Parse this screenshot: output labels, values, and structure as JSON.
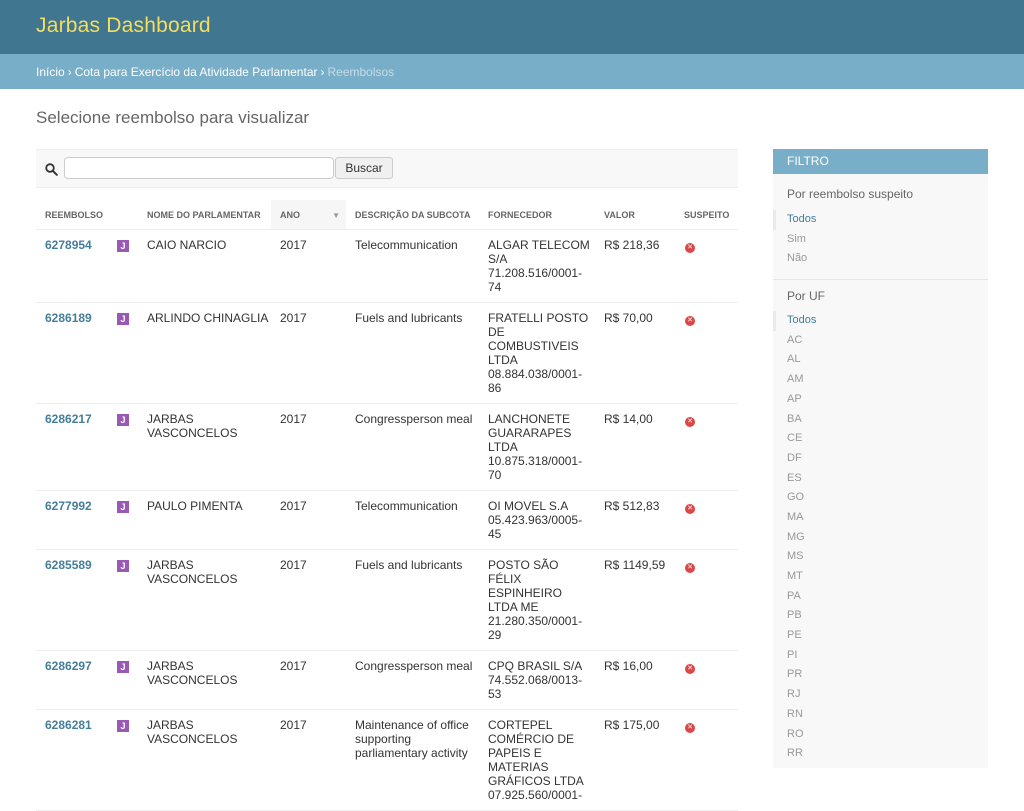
{
  "header": {
    "brand": "Jarbas Dashboard"
  },
  "breadcrumbs": {
    "home": "Início",
    "section": "Cota para Exercício da Atividade Parlamentar",
    "current": "Reembolsos",
    "separator": "›"
  },
  "page_title": "Selecione reembolso para visualizar",
  "search": {
    "placeholder": "",
    "value": "",
    "button": "Buscar",
    "icon": "search-icon"
  },
  "table": {
    "columns": {
      "reembolso": "REEMBOLSO",
      "parlamentar": "NOME DO PARLAMENTAR",
      "ano": "ANO",
      "subcota": "DESCRIÇÃO DA SUBCOTA",
      "fornecedor": "FORNECEDOR",
      "valor": "VALOR",
      "suspeito": "SUSPEITO"
    },
    "sorted_column": "ano",
    "jarbas_icon_letter": "J",
    "suspeito_icon_glyph": "✕",
    "rows": [
      {
        "id": "6278954",
        "name": "CAIO NARCIO",
        "year": "2017",
        "subquota": "Telecommunication",
        "supplier": "ALGAR TELECOM S/A 71.208.516/0001-74",
        "value": "R$ 218,36",
        "suspicious": false
      },
      {
        "id": "6286189",
        "name": "ARLINDO CHINAGLIA",
        "year": "2017",
        "subquota": "Fuels and lubricants",
        "supplier": "FRATELLI POSTO DE COMBUSTIVEIS LTDA 08.884.038/0001-86",
        "value": "R$ 70,00",
        "suspicious": false
      },
      {
        "id": "6286217",
        "name": "JARBAS VASCONCELOS",
        "year": "2017",
        "subquota": "Congressperson meal",
        "supplier": "LANCHONETE GUARARAPES LTDA 10.875.318/0001-70",
        "value": "R$ 14,00",
        "suspicious": false
      },
      {
        "id": "6277992",
        "name": "PAULO PIMENTA",
        "year": "2017",
        "subquota": "Telecommunication",
        "supplier": "OI MOVEL S.A 05.423.963/0005-45",
        "value": "R$ 512,83",
        "suspicious": false
      },
      {
        "id": "6285589",
        "name": "JARBAS VASCONCELOS",
        "year": "2017",
        "subquota": "Fuels and lubricants",
        "supplier": "POSTO SÃO FÉLIX ESPINHEIRO LTDA ME 21.280.350/0001-29",
        "value": "R$ 1149,59",
        "suspicious": false
      },
      {
        "id": "6286297",
        "name": "JARBAS VASCONCELOS",
        "year": "2017",
        "subquota": "Congressperson meal",
        "supplier": "CPQ BRASIL S/A 74.552.068/0013-53",
        "value": "R$ 16,00",
        "suspicious": false
      },
      {
        "id": "6286281",
        "name": "JARBAS VASCONCELOS",
        "year": "2017",
        "subquota": "Maintenance of office supporting parliamentary activity",
        "supplier": "CORTEPEL COMÉRCIO DE PAPEIS E MATERIAS GRÁFICOS LTDA 07.925.560/0001-",
        "value": "R$ 175,00",
        "suspicious": false
      }
    ]
  },
  "filter": {
    "title": "FILTRO",
    "suspicious": {
      "title": "Por reembolso suspeito",
      "selected": "Todos",
      "options": [
        "Todos",
        "Sim",
        "Não"
      ]
    },
    "uf": {
      "title": "Por UF",
      "selected": "Todos",
      "options": [
        "Todos",
        "AC",
        "AL",
        "AM",
        "AP",
        "BA",
        "CE",
        "DF",
        "ES",
        "GO",
        "MA",
        "MG",
        "MS",
        "MT",
        "PA",
        "PB",
        "PE",
        "PI",
        "PR",
        "RJ",
        "RN",
        "RO",
        "RR"
      ]
    }
  },
  "colors": {
    "header_bg": "#417690",
    "brand_text": "#f5dd5d",
    "breadcrumb_bg": "#79aec8",
    "link": "#447e9b",
    "jarbas_icon": "#9b59b6",
    "suspicious_icon": "#dd4646"
  }
}
